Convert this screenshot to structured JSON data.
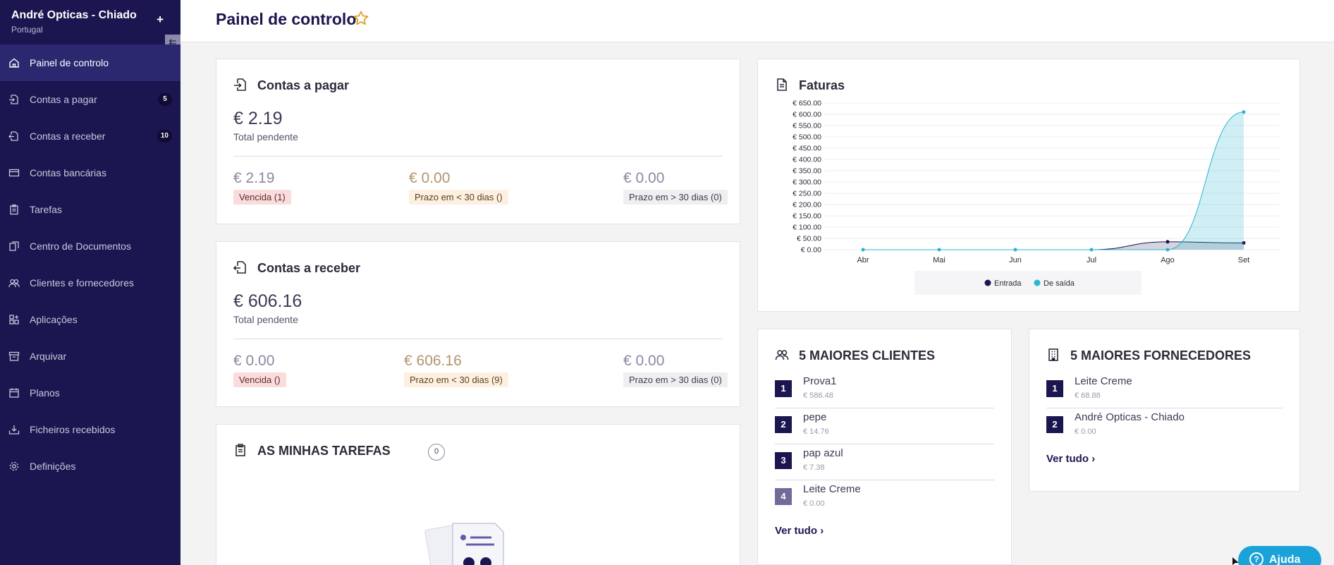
{
  "sidebar": {
    "company": "André Opticas - Chiado",
    "country": "Portugal",
    "items": [
      {
        "label": "Painel de controlo",
        "badge": ""
      },
      {
        "label": "Contas a pagar",
        "badge": "5"
      },
      {
        "label": "Contas a receber",
        "badge": "10"
      },
      {
        "label": "Contas bancárias",
        "badge": ""
      },
      {
        "label": "Tarefas",
        "badge": ""
      },
      {
        "label": "Centro de Documentos",
        "badge": ""
      },
      {
        "label": "Clientes e fornecedores",
        "badge": ""
      },
      {
        "label": "Aplicações",
        "badge": ""
      },
      {
        "label": "Arquivar",
        "badge": ""
      },
      {
        "label": "Planos",
        "badge": ""
      },
      {
        "label": "Ficheiros recebidos",
        "badge": ""
      },
      {
        "label": "Definições",
        "badge": ""
      }
    ]
  },
  "header": {
    "title": "Painel de controlo"
  },
  "payables": {
    "title": "Contas a pagar",
    "total": "€ 2.19",
    "total_label": "Total pendente",
    "overdue_amount": "€ 2.19",
    "overdue_label": "Vencida (1)",
    "due_soon_amount": "€ 0.00",
    "due_soon_label": "Prazo em < 30 dias ()",
    "due_later_amount": "€ 0.00",
    "due_later_label": "Prazo em > 30 dias (0)"
  },
  "receivables": {
    "title": "Contas a receber",
    "total": "€ 606.16",
    "total_label": "Total pendente",
    "overdue_amount": "€ 0.00",
    "overdue_label": "Vencida ()",
    "due_soon_amount": "€ 606.16",
    "due_soon_label": "Prazo em < 30 dias (9)",
    "due_later_amount": "€ 0.00",
    "due_later_label": "Prazo em > 30 dias (0)"
  },
  "tasks": {
    "title": "AS MINHAS TAREFAS",
    "count": "0"
  },
  "invoices": {
    "title": "Faturas"
  },
  "chart_data": {
    "type": "area",
    "categories": [
      "Abr",
      "Mai",
      "Jun",
      "Jul",
      "Ago",
      "Set"
    ],
    "y_ticks": [
      "€ 0.00",
      "€ 50.00",
      "€ 100.00",
      "€ 150.00",
      "€ 200.00",
      "€ 250.00",
      "€ 300.00",
      "€ 350.00",
      "€ 400.00",
      "€ 450.00",
      "€ 500.00",
      "€ 550.00",
      "€ 600.00",
      "€ 650.00"
    ],
    "ylim": [
      0,
      650
    ],
    "grid": true,
    "legend_position": "bottom",
    "series": [
      {
        "name": "Entrada",
        "color": "#1b1650",
        "values": [
          0,
          0,
          0,
          0,
          35,
          30
        ]
      },
      {
        "name": "De saída",
        "color": "#29b6d1",
        "values": [
          0,
          0,
          0,
          0,
          0,
          610
        ]
      }
    ]
  },
  "top_clients": {
    "title": "5 MAIORES CLIENTES",
    "items": [
      {
        "rank": "1",
        "name": "Prova1",
        "value": "€ 586.48"
      },
      {
        "rank": "2",
        "name": "pepe",
        "value": "€ 14.76"
      },
      {
        "rank": "3",
        "name": "pap azul",
        "value": "€ 7.38"
      },
      {
        "rank": "4",
        "name": "Leite Creme",
        "value": "€ 0.00"
      }
    ],
    "see_all": "Ver tudo"
  },
  "top_suppliers": {
    "title": "5 MAIORES FORNECEDORES",
    "items": [
      {
        "rank": "1",
        "name": "Leite Creme",
        "value": "€ 68.88"
      },
      {
        "rank": "2",
        "name": "André Opticas - Chiado",
        "value": "€ 0.00"
      }
    ],
    "see_all": "Ver tudo"
  },
  "help": {
    "label": "Ajuda"
  }
}
